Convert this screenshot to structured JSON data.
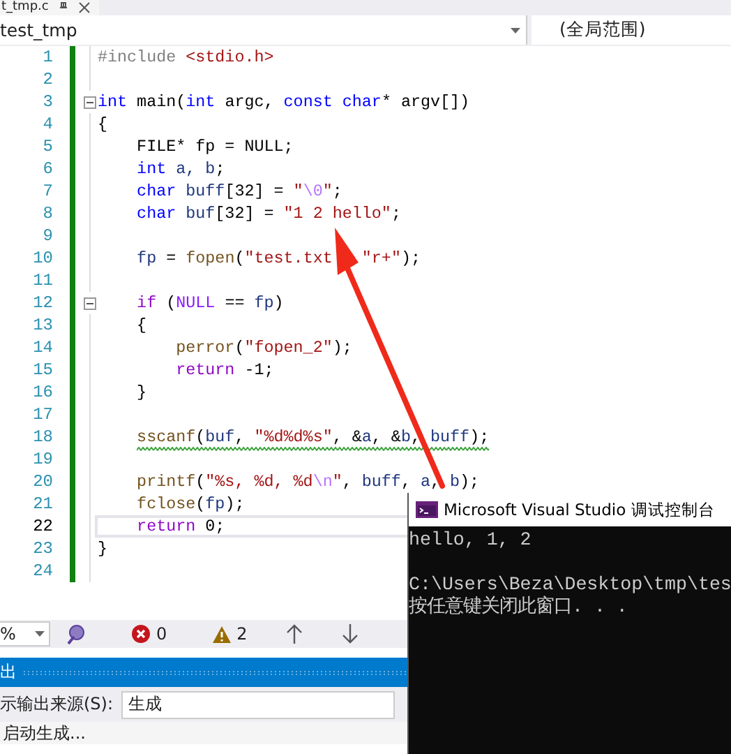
{
  "tab": {
    "label": "t_tmp.c"
  },
  "navbar": {
    "project": "test_tmp",
    "scope": "(全局范围)"
  },
  "editor": {
    "lines": [
      {
        "number": "1",
        "fold": false,
        "current": false,
        "warning": false,
        "tokens": [
          {
            "kind": "pre",
            "text": "#include "
          },
          {
            "kind": "str",
            "text": "<stdio.h>"
          }
        ]
      },
      {
        "number": "2",
        "fold": false,
        "current": false,
        "warning": false
      },
      {
        "number": "3",
        "fold": true,
        "current": false,
        "warning": false,
        "tokens": [
          {
            "kind": "kw",
            "text": "int"
          },
          {
            "kind": "p",
            "text": " main("
          },
          {
            "kind": "kw",
            "text": "int"
          },
          {
            "kind": "p",
            "text": " argc, "
          },
          {
            "kind": "kw",
            "text": "const"
          },
          {
            "kind": "kw",
            "text": " char"
          },
          {
            "kind": "p",
            "text": "* argv[])"
          }
        ]
      },
      {
        "number": "4",
        "fold": false,
        "current": false,
        "warning": false,
        "tokens": [
          {
            "kind": "p",
            "text": "{"
          }
        ]
      },
      {
        "number": "5",
        "fold": false,
        "current": false,
        "warning": false,
        "tokens": [
          {
            "kind": "p",
            "text": "    FILE* fp = NULL;"
          }
        ]
      },
      {
        "number": "6",
        "fold": false,
        "current": false,
        "warning": false,
        "tokens": [
          {
            "kind": "kw",
            "text": "    int"
          },
          {
            "kind": "var",
            "text": " a, b"
          },
          {
            "kind": "p",
            "text": ";"
          }
        ]
      },
      {
        "number": "7",
        "fold": false,
        "current": false,
        "warning": false,
        "tokens": [
          {
            "kind": "kw",
            "text": "    char"
          },
          {
            "kind": "var",
            "text": " buff"
          },
          {
            "kind": "p",
            "text": "[32] = "
          },
          {
            "kind": "str",
            "text": "\""
          },
          {
            "kind": "esc",
            "text": "\\0"
          },
          {
            "kind": "str",
            "text": "\""
          },
          {
            "kind": "p",
            "text": ";"
          }
        ]
      },
      {
        "number": "8",
        "fold": false,
        "current": false,
        "warning": false,
        "tokens": [
          {
            "kind": "kw",
            "text": "    char"
          },
          {
            "kind": "var",
            "text": " buf"
          },
          {
            "kind": "p",
            "text": "[32] = "
          },
          {
            "kind": "str",
            "text": "\"1 2 hello\""
          },
          {
            "kind": "p",
            "text": ";"
          }
        ]
      },
      {
        "number": "9",
        "fold": false,
        "current": false,
        "warning": false
      },
      {
        "number": "10",
        "fold": false,
        "current": false,
        "warning": false,
        "tokens": [
          {
            "kind": "var",
            "text": "    fp"
          },
          {
            "kind": "p",
            "text": " = "
          },
          {
            "kind": "fn",
            "text": "fopen"
          },
          {
            "kind": "p",
            "text": "("
          },
          {
            "kind": "str",
            "text": "\"test.txt"
          },
          {
            "kind": "str",
            "text": "   \"r+\""
          },
          {
            "kind": "p",
            "text": ");"
          }
        ]
      },
      {
        "number": "11",
        "fold": false,
        "current": false,
        "warning": false
      },
      {
        "number": "12",
        "fold": true,
        "current": false,
        "warning": false,
        "tokens": [
          {
            "kind": "ctl",
            "text": "    if"
          },
          {
            "kind": "p",
            "text": " ("
          },
          {
            "kind": "mac",
            "text": "NULL"
          },
          {
            "kind": "p",
            "text": " == "
          },
          {
            "kind": "var",
            "text": "fp"
          },
          {
            "kind": "p",
            "text": ")"
          }
        ]
      },
      {
        "number": "13",
        "fold": false,
        "current": false,
        "warning": false,
        "tokens": [
          {
            "kind": "p",
            "text": "    {"
          }
        ]
      },
      {
        "number": "14",
        "fold": false,
        "current": false,
        "warning": false,
        "tokens": [
          {
            "kind": "fn",
            "text": "        perror"
          },
          {
            "kind": "p",
            "text": "("
          },
          {
            "kind": "str",
            "text": "\"fopen_2\""
          },
          {
            "kind": "p",
            "text": ");"
          }
        ]
      },
      {
        "number": "15",
        "fold": false,
        "current": false,
        "warning": false,
        "tokens": [
          {
            "kind": "ctl",
            "text": "        return"
          },
          {
            "kind": "p",
            "text": " -1;"
          }
        ]
      },
      {
        "number": "16",
        "fold": false,
        "current": false,
        "warning": false,
        "tokens": [
          {
            "kind": "p",
            "text": "    }"
          }
        ]
      },
      {
        "number": "17",
        "fold": false,
        "current": false,
        "warning": false
      },
      {
        "number": "18",
        "fold": false,
        "current": false,
        "warning": true,
        "tokens": [
          {
            "kind": "fn",
            "text": "    sscanf"
          },
          {
            "kind": "p",
            "text": "("
          },
          {
            "kind": "var",
            "text": "buf"
          },
          {
            "kind": "p",
            "text": ", "
          },
          {
            "kind": "str",
            "text": "\"%d%d%s\""
          },
          {
            "kind": "p",
            "text": ", &"
          },
          {
            "kind": "var",
            "text": "a"
          },
          {
            "kind": "p",
            "text": ", &"
          },
          {
            "kind": "var",
            "text": "b"
          },
          {
            "kind": "p",
            "text": ", "
          },
          {
            "kind": "var",
            "text": "buff"
          },
          {
            "kind": "p",
            "text": ");"
          }
        ]
      },
      {
        "number": "19",
        "fold": false,
        "current": false,
        "warning": false
      },
      {
        "number": "20",
        "fold": false,
        "current": false,
        "warning": false,
        "tokens": [
          {
            "kind": "fn",
            "text": "    printf"
          },
          {
            "kind": "p",
            "text": "("
          },
          {
            "kind": "str",
            "text": "\"%s, %d, %d"
          },
          {
            "kind": "esc",
            "text": "\\n"
          },
          {
            "kind": "str",
            "text": "\""
          },
          {
            "kind": "p",
            "text": ", "
          },
          {
            "kind": "var",
            "text": "buff"
          },
          {
            "kind": "p",
            "text": ", "
          },
          {
            "kind": "var",
            "text": "a"
          },
          {
            "kind": "p",
            "text": ", "
          },
          {
            "kind": "var",
            "text": "b"
          },
          {
            "kind": "p",
            "text": ");"
          }
        ]
      },
      {
        "number": "21",
        "fold": false,
        "current": false,
        "warning": false,
        "tokens": [
          {
            "kind": "fn",
            "text": "    fclose"
          },
          {
            "kind": "p",
            "text": "("
          },
          {
            "kind": "var",
            "text": "fp"
          },
          {
            "kind": "p",
            "text": ");"
          }
        ]
      },
      {
        "number": "22",
        "fold": false,
        "current": true,
        "warning": false,
        "tokens": [
          {
            "kind": "ctl",
            "text": "    return"
          },
          {
            "kind": "p",
            "text": " 0;"
          }
        ]
      },
      {
        "number": "23",
        "fold": false,
        "current": false,
        "warning": false,
        "tokens": [
          {
            "kind": "p",
            "text": "}"
          }
        ]
      },
      {
        "number": "24",
        "fold": false,
        "current": false,
        "warning": false
      }
    ]
  },
  "status": {
    "zoom": "%",
    "errors": "0",
    "warnings": "2"
  },
  "output": {
    "title": "出",
    "source_label": "示输出来源(S):",
    "source": "生成",
    "lines": [
      "启动生成..."
    ]
  },
  "console": {
    "title": "Microsoft Visual Studio 调试控制台",
    "paragraphs": [
      [
        "hello, 1, 2"
      ],
      [
        "C:\\Users\\Beza\\Desktop\\tmp\\tes",
        "按任意键关闭此窗口. . ."
      ]
    ]
  }
}
